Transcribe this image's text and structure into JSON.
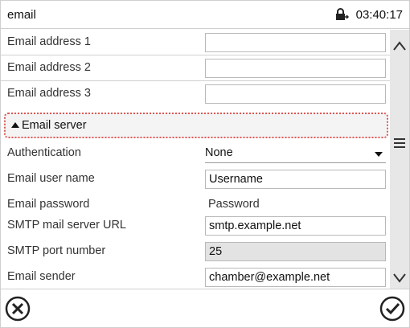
{
  "window": {
    "title": "email",
    "time": "03:40:17"
  },
  "icons": {
    "lock": "padlock-icon",
    "scroll_up": "chevron-up-icon",
    "scroll_down": "chevron-down-icon",
    "scroll_handle": "hamburger-icon",
    "cancel": "circle-x-icon",
    "confirm": "circle-check-icon"
  },
  "fields": {
    "email_address_1": {
      "label": "Email address 1",
      "value": ""
    },
    "email_address_2": {
      "label": "Email address 2",
      "value": ""
    },
    "email_address_3": {
      "label": "Email address 3",
      "value": ""
    },
    "section_email_server": {
      "label": "Email server"
    },
    "authentication": {
      "label": "Authentication",
      "value": "None"
    },
    "email_user_name": {
      "label": "Email user name",
      "value": "Username"
    },
    "email_password": {
      "label": "Email password",
      "value": "Password"
    },
    "smtp_url": {
      "label": "SMTP mail server URL",
      "value": "smtp.example.net"
    },
    "smtp_port": {
      "label": "SMTP port number",
      "value": "25"
    },
    "email_sender": {
      "label": "Email sender",
      "value": "chamber@example.net"
    }
  },
  "colors": {
    "focus_outline": "#e05757",
    "readonly_field": "#e3e3e3",
    "scrollbar": "#e7e7e7"
  }
}
